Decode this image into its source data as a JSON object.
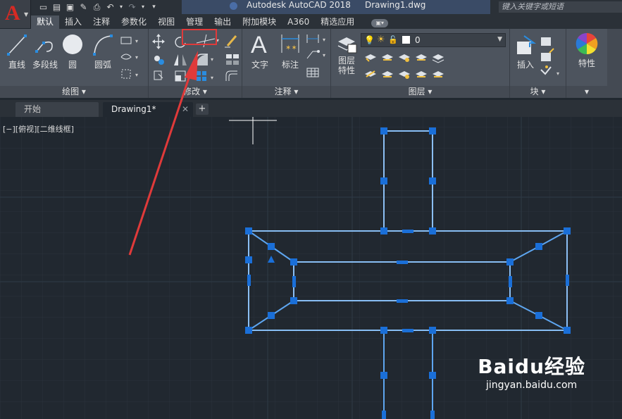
{
  "app": {
    "title": "Autodesk AutoCAD 2018",
    "document": "Drawing1.dwg",
    "logo_letter": "A"
  },
  "search": {
    "placeholder": "键入关键字或短语"
  },
  "tabs": [
    {
      "label": "默认",
      "active": true
    },
    {
      "label": "插入"
    },
    {
      "label": "注释"
    },
    {
      "label": "参数化"
    },
    {
      "label": "视图"
    },
    {
      "label": "管理"
    },
    {
      "label": "输出"
    },
    {
      "label": "附加模块"
    },
    {
      "label": "A360"
    },
    {
      "label": "精选应用"
    }
  ],
  "ribbon": {
    "draw": {
      "title": "绘图 ▾",
      "line": "直线",
      "polyline": "多段线",
      "circle": "圆",
      "arc": "圆弧"
    },
    "modify": {
      "title": "修改 ▾"
    },
    "annotation": {
      "title": "注释 ▾",
      "text": "文字",
      "dimension": "标注"
    },
    "layers": {
      "title": "图层 ▾",
      "layer_props": "图层\n特性",
      "layer_props_l1": "图层",
      "layer_props_l2": "特性",
      "current_layer": "0"
    },
    "block": {
      "title": "块 ▾",
      "insert": "插入"
    },
    "properties": {
      "title": "▾",
      "label": "特性"
    }
  },
  "file_tabs": [
    {
      "label": "开始"
    },
    {
      "label": "Drawing1*",
      "active": true
    }
  ],
  "viewport": {
    "label": "[−][俯视][二维线框]"
  },
  "watermark": {
    "main": "Baidu经验",
    "sub": "jingyan.baidu.com"
  },
  "colors": {
    "accent": "#1e7ad6",
    "grip": "#1a6fd8",
    "highlight": "#e03a3a",
    "background": "#212830"
  }
}
